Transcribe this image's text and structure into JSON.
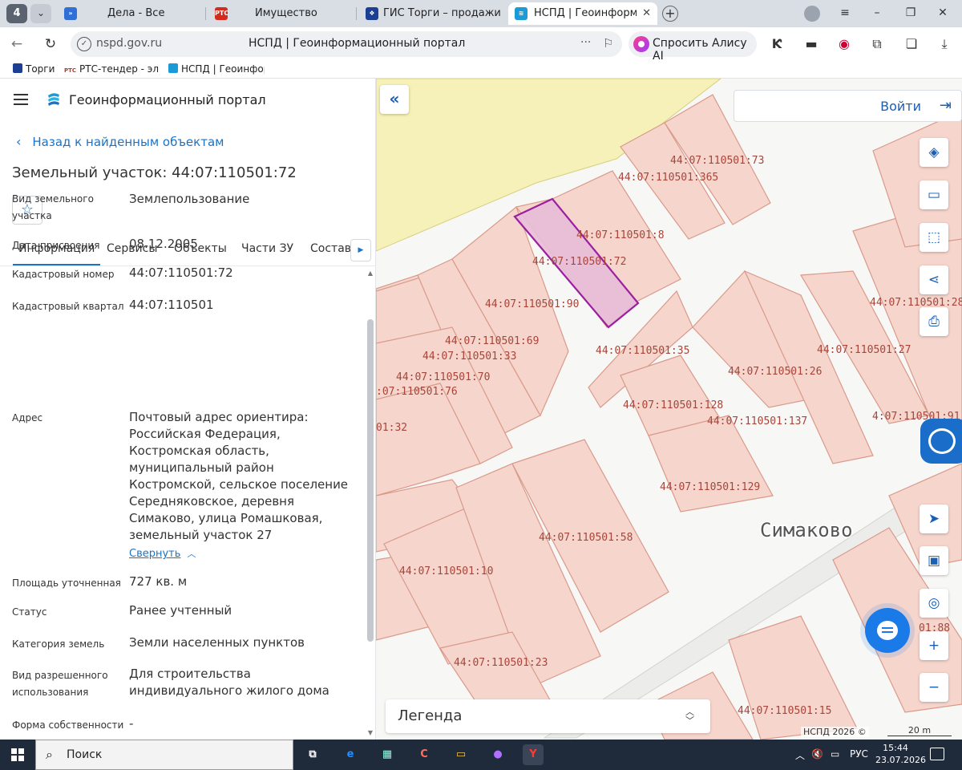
{
  "browser": {
    "tab_count": "4",
    "tabs": [
      {
        "label": "Дела - Все"
      },
      {
        "label": "Имущество",
        "favicon": "РТС"
      },
      {
        "label": "ГИС Торги – продажи гос"
      },
      {
        "label": "НСПД | Геоинформацион"
      }
    ],
    "url_domain": "nspd.gov.ru",
    "page_title": "НСПД | Геоинформационный портал",
    "alice_label": "Спросить Алису AI",
    "bookmarks": [
      {
        "label": "Торги"
      },
      {
        "label": "РТС-тендер - эле",
        "favicon": "РТС"
      },
      {
        "label": "НСПД | Геоинфор"
      }
    ]
  },
  "colors": {
    "accent": "#1a73c8",
    "parcel_fill": "#f6d5cc",
    "parcel_stroke": "#d99a8a",
    "selected_fill": "#e8bcd8",
    "selected_stroke": "#9b1fa0",
    "label_color": "#a8453a"
  },
  "panel": {
    "brand": "Геоинформационный портал",
    "back_link": "Назад к найденным объектам",
    "title": "Земельный участок: 44:07:110501:72",
    "tabs": [
      "Информация",
      "Сервисы",
      "Объекты",
      "Части ЗУ",
      "Состав"
    ],
    "info_rows": [
      {
        "label": "Вид земельного участка",
        "value": "Землепользование"
      },
      {
        "label": "Дата присвоения",
        "value": "08.12.2005"
      },
      {
        "label": "Кадастровый номер",
        "value": "44:07:110501:72"
      },
      {
        "label": "Кадастровый квартал",
        "value": "44:07:110501"
      },
      {
        "label": "Адрес",
        "value": "Почтовый адрес ориентира: Российская Федерация, Костромская область, муниципальный район Костромской, сельское поселение Середняковское, деревня Симаково, улица Ромашковая, земельный участок 27"
      },
      {
        "label": "Площадь уточненная",
        "value": "727 кв. м"
      },
      {
        "label": "Статус",
        "value": "Ранее учтенный"
      },
      {
        "label": "Категория земель",
        "value": "Земли населенных пунктов"
      },
      {
        "label": "Вид разрешенного использования",
        "value": "Для строительства индивидуального жилого дома"
      },
      {
        "label": "Форма собственности",
        "value": "-"
      }
    ],
    "collapse_label": "Свернуть"
  },
  "map": {
    "login_label": "Войти",
    "legend_label": "Легенда",
    "place_name": "Симаково",
    "copyright": "НСПД 2026 ©",
    "scale": "20 m",
    "parcel_labels": [
      "44:07:110501:73",
      "44:07:110501:365",
      "44:07:110501:8",
      "44:07:110501:72",
      "44:07:110501:90",
      "44:07:110501:28",
      "44:07:110501:69",
      "44:07:110501:33",
      "44:07:110501:35",
      "44:07:110501:27",
      "44:07:110501:70",
      "44:07:110501:26",
      ":07:110501:76",
      "44:07:110501:128",
      "44:07:110501:137",
      "4:07:110501:91",
      "01:32",
      "44:07:110501:129",
      "44:07:110501:58",
      "44:07:110501:10",
      "44:07:110501:23",
      "01:88",
      "44:07:110501:15"
    ]
  },
  "taskbar": {
    "search_label": "Поиск",
    "lang": "РУС",
    "time": "15:44",
    "date": "23.07.2026"
  }
}
